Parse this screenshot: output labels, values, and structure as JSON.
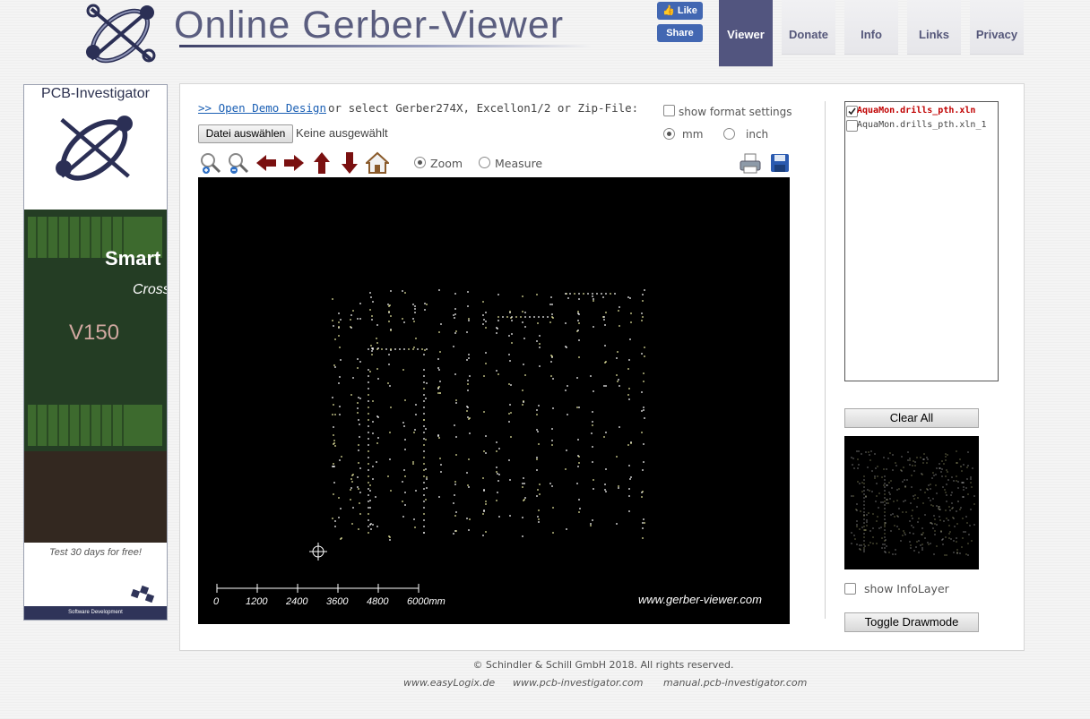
{
  "header": {
    "title": "Online Gerber-Viewer",
    "facebook": {
      "like": "Like",
      "share": "Share"
    },
    "nav": [
      {
        "label": "Viewer",
        "active": true
      },
      {
        "label": "Donate"
      },
      {
        "label": "Info"
      },
      {
        "label": "Links"
      },
      {
        "label": "Privacy"
      }
    ]
  },
  "ad": {
    "title": "PCB-Investigator",
    "headline": "Smart S",
    "subline": "Cross",
    "version": "V150",
    "trial": "Test 30 days for free!",
    "footer": "Software Development"
  },
  "loader": {
    "demo_link": ">> Open Demo Design",
    "select_text": "or select Gerber274X, Excellon1/2 or Zip-File:",
    "file_button": "Datei auswählen",
    "file_status": "Keine ausgewählt"
  },
  "settings": {
    "format_label": "show format settings",
    "units": {
      "mm": "mm",
      "inch": "inch",
      "selected": "mm"
    }
  },
  "toolbar": {
    "modes": {
      "zoom": "Zoom",
      "measure": "Measure",
      "selected": "Zoom"
    }
  },
  "viewer": {
    "url": "www.gerber-viewer.com",
    "scale_labels": [
      "0",
      "1200",
      "2400",
      "3600",
      "4800",
      "6000mm"
    ]
  },
  "layers": [
    {
      "name": "AquaMon.drills_pth.xln",
      "checked": true
    },
    {
      "name": "AquaMon.drills_pth.xln_1",
      "checked": false
    }
  ],
  "sidebar": {
    "clear_all": "Clear All",
    "info_layer": "show InfoLayer",
    "toggle_drawmode": "Toggle Drawmode"
  },
  "footer": {
    "copyright": "© Schindler & Schill GmbH 2018. All rights reserved.",
    "links": [
      "www.easyLogix.de",
      "www.pcb-investigator.com",
      "manual.pcb-investigator.com"
    ]
  },
  "colors": {
    "brand": "#52557f",
    "link": "#1a5fb4",
    "layer_active": "#c00000",
    "viewer_bg": "#000000"
  }
}
